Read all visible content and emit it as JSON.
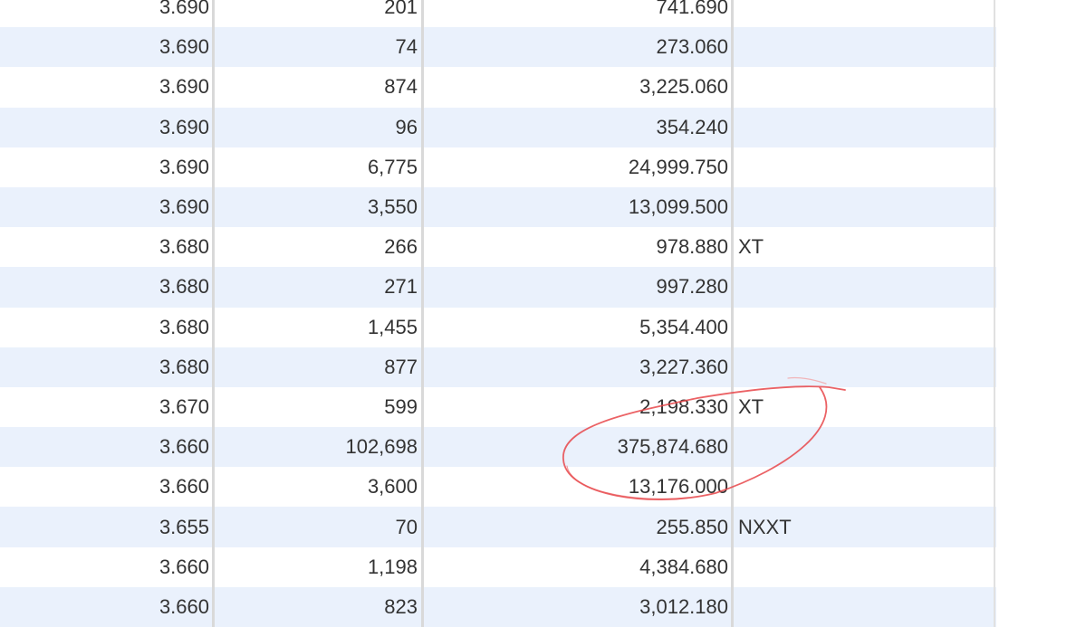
{
  "rows": [
    {
      "price": "3.690",
      "volume": "201",
      "value": "741.690",
      "condition": ""
    },
    {
      "price": "3.690",
      "volume": "74",
      "value": "273.060",
      "condition": ""
    },
    {
      "price": "3.690",
      "volume": "874",
      "value": "3,225.060",
      "condition": ""
    },
    {
      "price": "3.690",
      "volume": "96",
      "value": "354.240",
      "condition": ""
    },
    {
      "price": "3.690",
      "volume": "6,775",
      "value": "24,999.750",
      "condition": ""
    },
    {
      "price": "3.690",
      "volume": "3,550",
      "value": "13,099.500",
      "condition": ""
    },
    {
      "price": "3.680",
      "volume": "266",
      "value": "978.880",
      "condition": "XT"
    },
    {
      "price": "3.680",
      "volume": "271",
      "value": "997.280",
      "condition": ""
    },
    {
      "price": "3.680",
      "volume": "1,455",
      "value": "5,354.400",
      "condition": ""
    },
    {
      "price": "3.680",
      "volume": "877",
      "value": "3,227.360",
      "condition": ""
    },
    {
      "price": "3.670",
      "volume": "599",
      "value": "2,198.330",
      "condition": "XT"
    },
    {
      "price": "3.660",
      "volume": "102,698",
      "value": "375,874.680",
      "condition": ""
    },
    {
      "price": "3.660",
      "volume": "3,600",
      "value": "13,176.000",
      "condition": ""
    },
    {
      "price": "3.655",
      "volume": "70",
      "value": "255.850",
      "condition": "NXXT"
    },
    {
      "price": "3.660",
      "volume": "1,198",
      "value": "4,384.680",
      "condition": ""
    },
    {
      "price": "3.660",
      "volume": "823",
      "value": "3,012.180",
      "condition": ""
    }
  ],
  "colors": {
    "row_alt": "#eaf1fc",
    "row_plain": "#ffffff",
    "text": "#333333",
    "annotation": "#e8474a",
    "divider": "#d9d9d9"
  }
}
